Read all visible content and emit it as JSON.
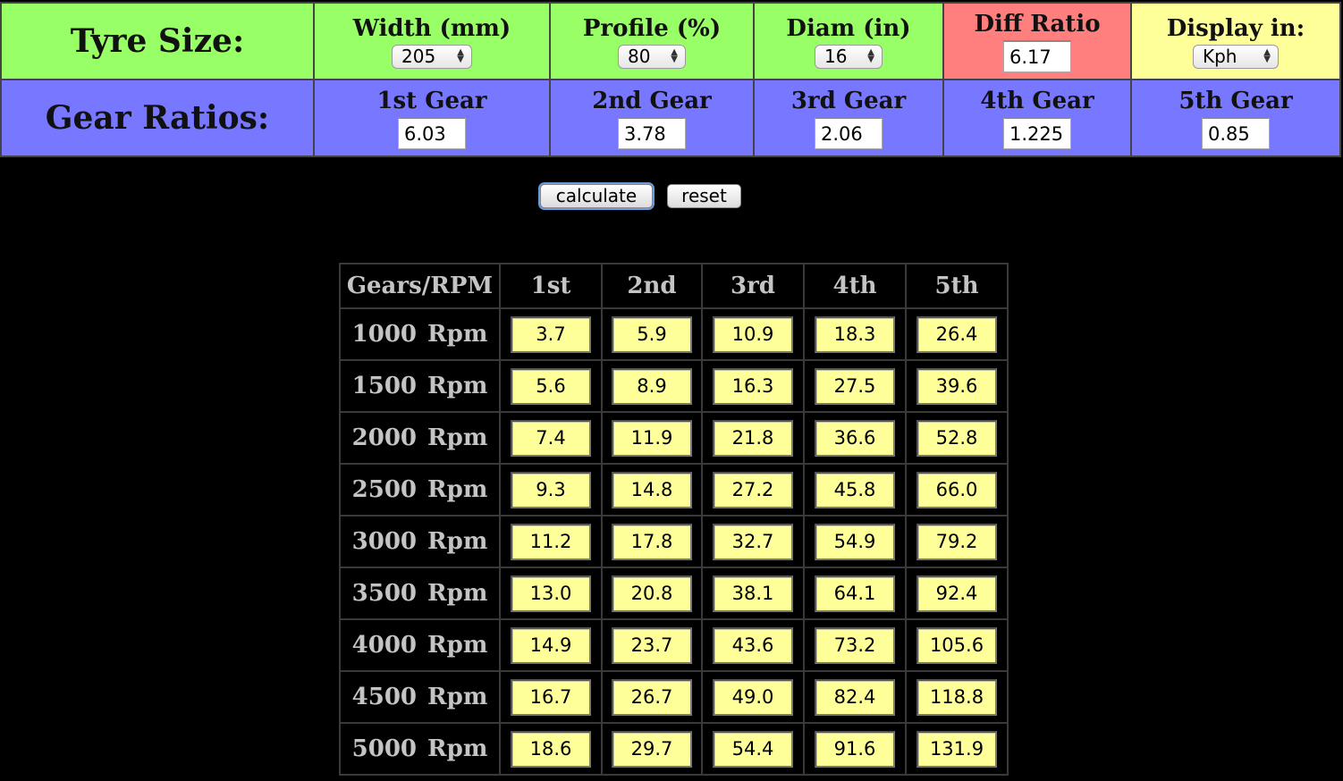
{
  "tyre_size": {
    "title": "Tyre Size:",
    "width": {
      "label": "Width (mm)",
      "value": "205"
    },
    "profile": {
      "label": "Profile (%)",
      "value": "80"
    },
    "diam": {
      "label": "Diam (in)",
      "value": "16"
    },
    "diff": {
      "label": "Diff Ratio",
      "value": "6.17"
    },
    "display": {
      "label": "Display in:",
      "value": "Kph"
    }
  },
  "gear_ratios": {
    "title": "Gear Ratios:",
    "items": [
      {
        "label": "1st Gear",
        "value": "6.03"
      },
      {
        "label": "2nd Gear",
        "value": "3.78"
      },
      {
        "label": "3rd Gear",
        "value": "2.06"
      },
      {
        "label": "4th Gear",
        "value": "1.225"
      },
      {
        "label": "5th Gear",
        "value": "0.85"
      }
    ]
  },
  "buttons": {
    "calculate": "calculate",
    "reset": "reset"
  },
  "results": {
    "header": [
      "Gears/RPM",
      "1st",
      "2nd",
      "3rd",
      "4th",
      "5th"
    ],
    "rpm_unit": "Rpm",
    "rows": [
      {
        "rpm": "1000",
        "values": [
          "3.7",
          "5.9",
          "10.9",
          "18.3",
          "26.4"
        ]
      },
      {
        "rpm": "1500",
        "values": [
          "5.6",
          "8.9",
          "16.3",
          "27.5",
          "39.6"
        ]
      },
      {
        "rpm": "2000",
        "values": [
          "7.4",
          "11.9",
          "21.8",
          "36.6",
          "52.8"
        ]
      },
      {
        "rpm": "2500",
        "values": [
          "9.3",
          "14.8",
          "27.2",
          "45.8",
          "66.0"
        ]
      },
      {
        "rpm": "3000",
        "values": [
          "11.2",
          "17.8",
          "32.7",
          "54.9",
          "79.2"
        ]
      },
      {
        "rpm": "3500",
        "values": [
          "13.0",
          "20.8",
          "38.1",
          "64.1",
          "92.4"
        ]
      },
      {
        "rpm": "4000",
        "values": [
          "14.9",
          "23.7",
          "43.6",
          "73.2",
          "105.6"
        ]
      },
      {
        "rpm": "4500",
        "values": [
          "16.7",
          "26.7",
          "49.0",
          "82.4",
          "118.8"
        ]
      },
      {
        "rpm": "5000",
        "values": [
          "18.6",
          "29.7",
          "54.4",
          "91.6",
          "131.9"
        ]
      }
    ]
  },
  "colors": {
    "tyre_row": "#99ff66",
    "gear_row": "#7777ff",
    "diff_cell": "#ff7f7f",
    "display_cell": "#ffff99",
    "speed_cell": "#ffff99",
    "background": "#000000"
  }
}
